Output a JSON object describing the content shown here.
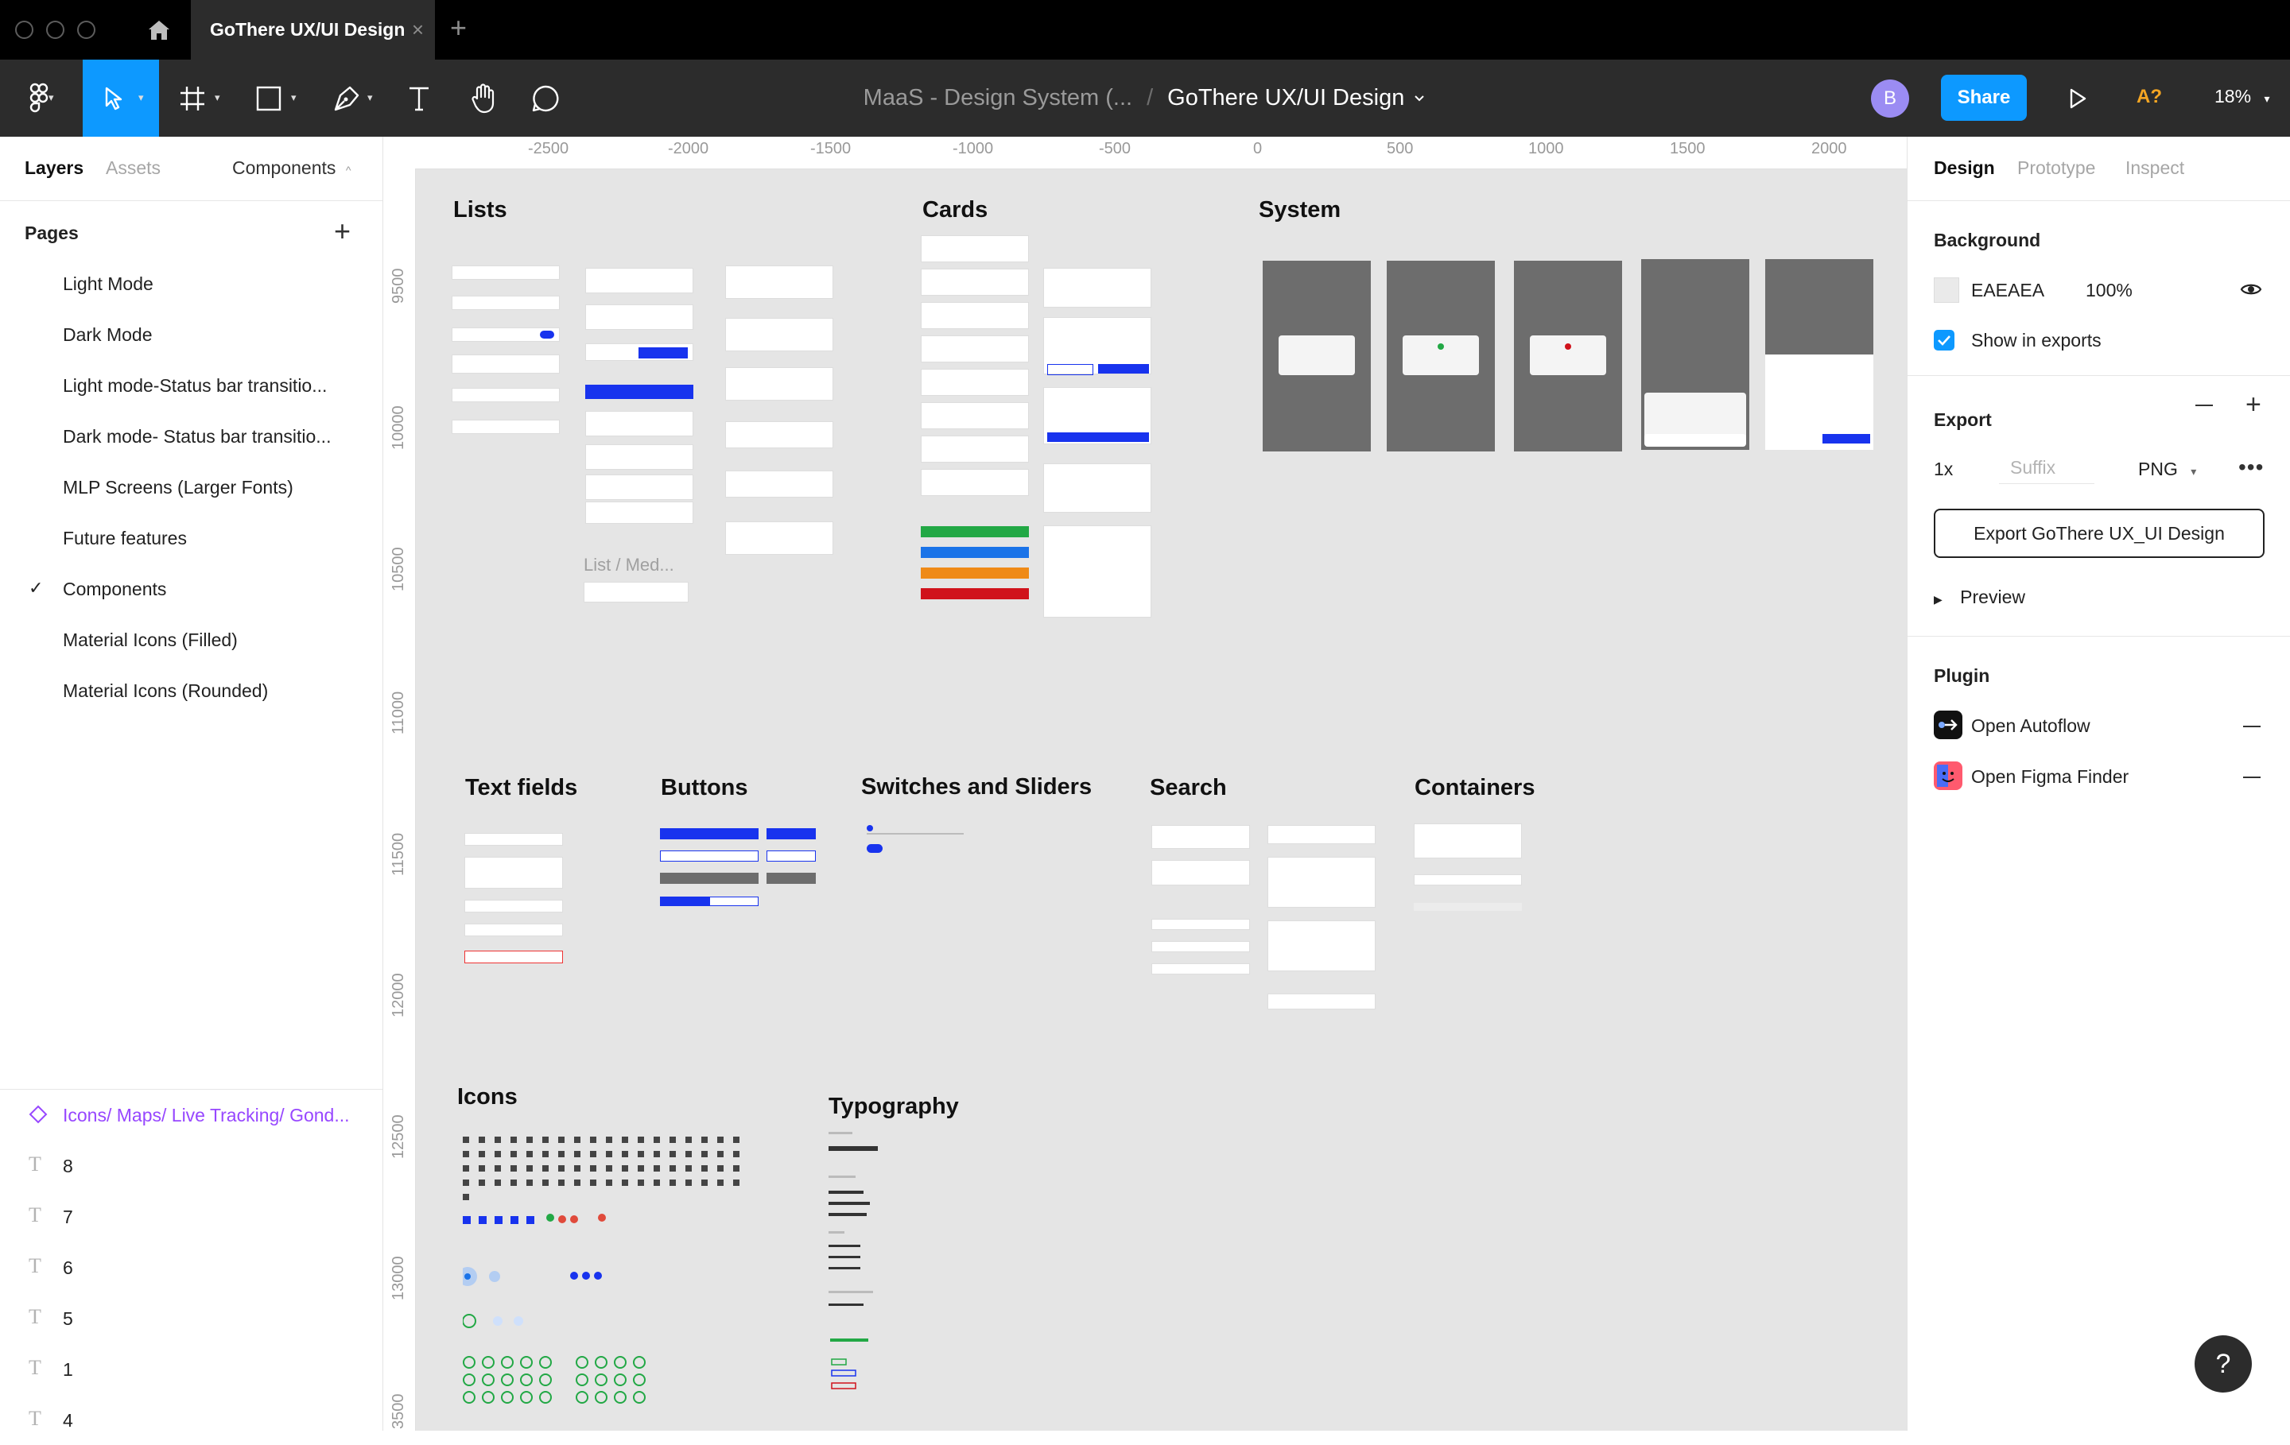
{
  "window": {
    "tab_title": "GoThere UX/UI Design",
    "close_tab_icon": "×",
    "new_tab_icon": "+"
  },
  "toolbar": {
    "breadcrumb_parent": "MaaS - Design System (...",
    "breadcrumb_separator": "/",
    "file_name": "GoThere UX/UI Design",
    "avatar_initial": "B",
    "share_label": "Share",
    "accessibility_label": "A?",
    "zoom_level": "18%"
  },
  "left_panel": {
    "tabs": [
      "Layers",
      "Assets",
      "Components"
    ],
    "pages_title": "Pages",
    "pages": [
      "Light Mode",
      "Dark Mode",
      "Light mode-Status bar transitio...",
      "Dark mode- Status bar transitio...",
      "MLP Screens (Larger Fonts)",
      "Future features",
      "Components",
      "Material Icons (Filled)",
      "Material Icons (Rounded)"
    ],
    "current_page": "Components",
    "layers": [
      {
        "icon": "component-icon",
        "label": "Icons/ Maps/ Live Tracking/ Gond..."
      },
      {
        "icon": "text-icon",
        "label": "8"
      },
      {
        "icon": "text-icon",
        "label": "7"
      },
      {
        "icon": "text-icon",
        "label": "6"
      },
      {
        "icon": "text-icon",
        "label": "5"
      },
      {
        "icon": "text-icon",
        "label": "1"
      },
      {
        "icon": "text-icon",
        "label": "4"
      }
    ]
  },
  "canvas": {
    "ruler_top": [
      "-2500",
      "-2000",
      "-1500",
      "-1000",
      "-500",
      "0",
      "500",
      "1000",
      "1500",
      "2000"
    ],
    "ruler_left": [
      "9500",
      "10000",
      "10500",
      "11000",
      "11500",
      "12000",
      "12500",
      "13000",
      "3500"
    ],
    "sections": {
      "lists": "Lists",
      "cards": "Cards",
      "system": "System",
      "text_fields": "Text fields",
      "buttons": "Buttons",
      "switches": "Switches and Sliders",
      "search": "Search",
      "containers": "Containers",
      "icons": "Icons",
      "typography": "Typography"
    },
    "list_med_label": "List / Med..."
  },
  "right_panel": {
    "tabs": [
      "Design",
      "Prototype",
      "Inspect"
    ],
    "background_title": "Background",
    "background_hex": "EAEAEA",
    "background_opacity": "100%",
    "show_in_exports": "Show in exports",
    "export_title": "Export",
    "export_scale": "1x",
    "export_suffix_placeholder": "Suffix",
    "export_format": "PNG",
    "export_button": "Export GoThere UX_UI Design",
    "preview_label": "Preview",
    "plugin_title": "Plugin",
    "plugins": [
      "Open Autoflow",
      "Open Figma Finder"
    ]
  },
  "colors": {
    "accent": "#0d99ff",
    "toolbar_bg": "#2c2c2c",
    "canvas_bg": "#e5e5e5",
    "component_purple": "#9747ff"
  },
  "help_label": "?"
}
